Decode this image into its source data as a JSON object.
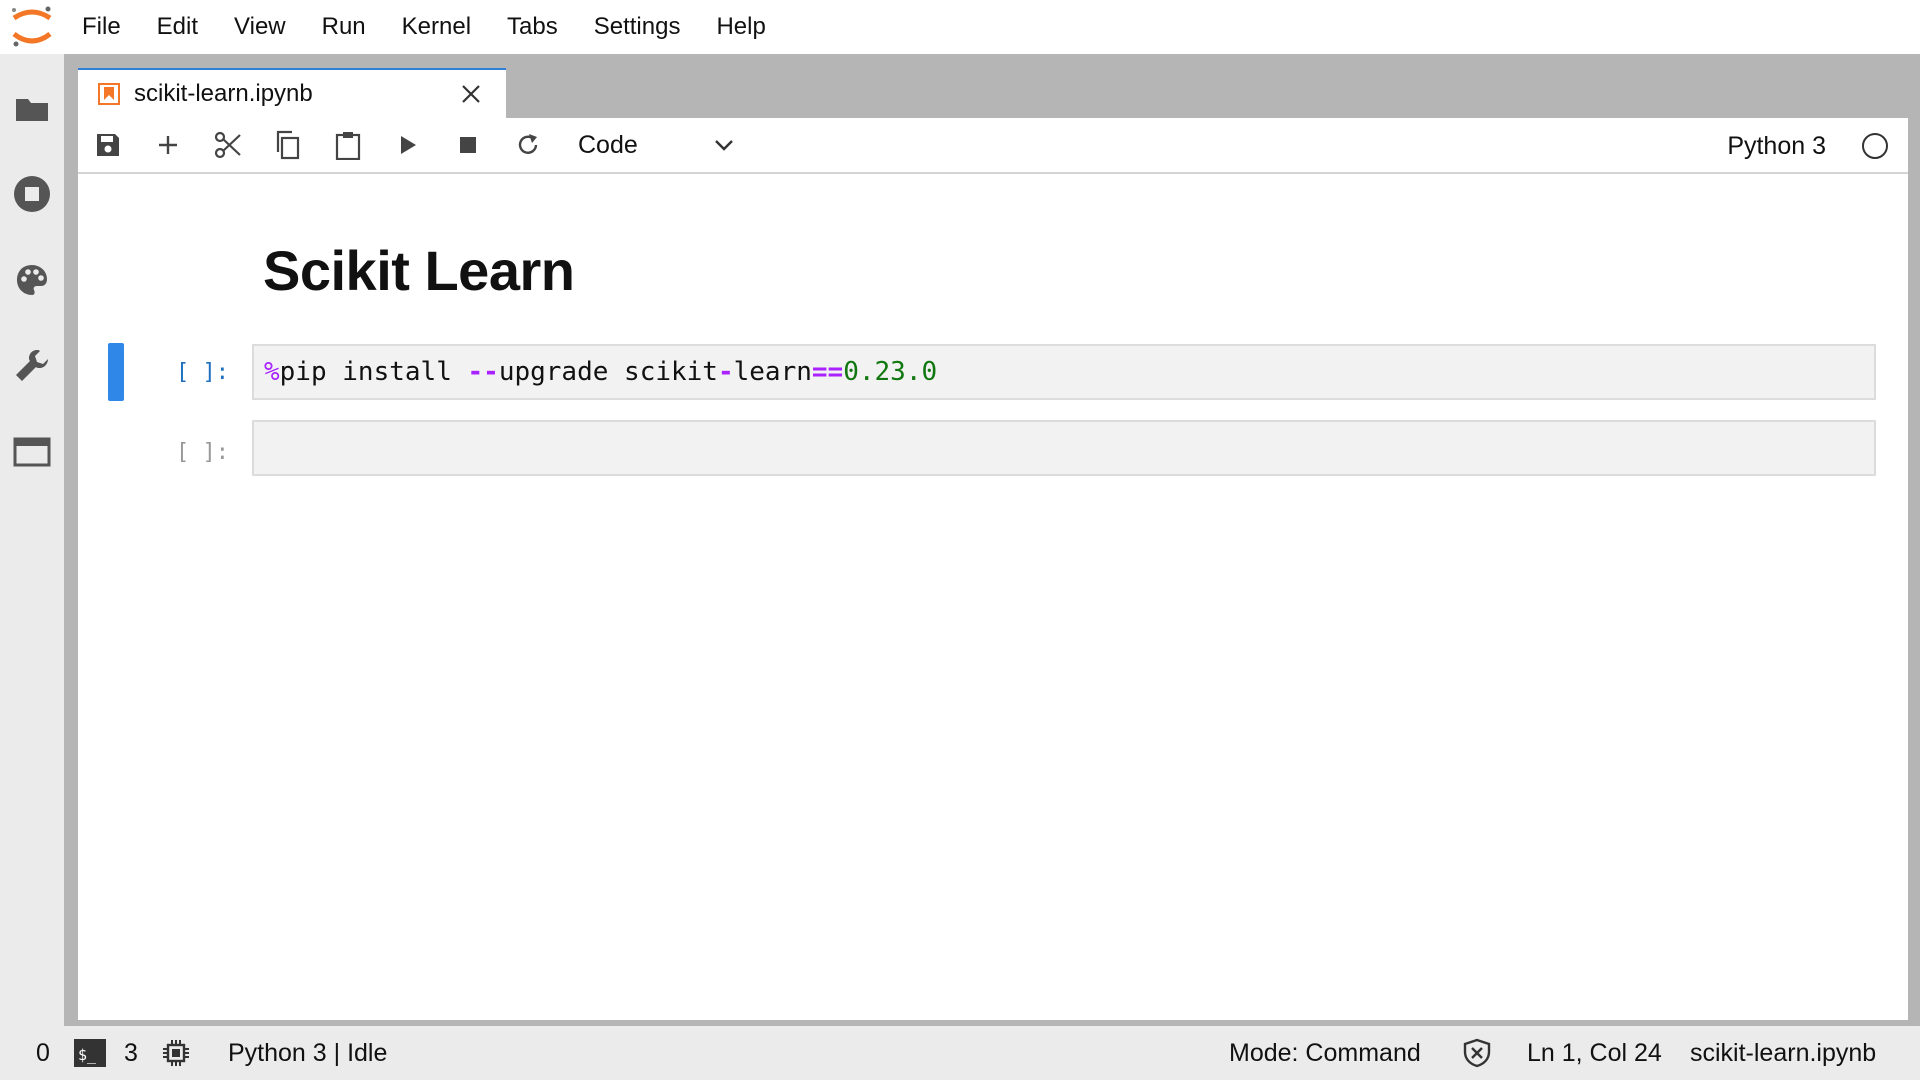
{
  "menubar": {
    "items": [
      "File",
      "Edit",
      "View",
      "Run",
      "Kernel",
      "Tabs",
      "Settings",
      "Help"
    ]
  },
  "sidebar": {
    "icons": [
      "folder-icon",
      "running-icon",
      "palette-icon",
      "wrench-icon",
      "tabs-icon"
    ]
  },
  "tab": {
    "title": "scikit-learn.ipynb",
    "icon": "notebook-icon"
  },
  "toolbar": {
    "buttons": [
      "save-icon",
      "plus-icon",
      "cut-icon",
      "copy-icon",
      "paste-icon",
      "run-icon",
      "stop-icon",
      "restart-icon"
    ],
    "cell_type": "Code",
    "kernel_name": "Python 3"
  },
  "notebook": {
    "heading": "Scikit Learn",
    "cells": [
      {
        "prompt": "[ ]:",
        "code": {
          "magic": "%",
          "cmd": "pip install ",
          "dash": "--",
          "arg": "upgrade scikit",
          "dash2": "-",
          "arg2": "learn",
          "eq": "==",
          "version": "0.23.0"
        }
      },
      {
        "prompt": "[ ]:",
        "code": ""
      }
    ]
  },
  "statusbar": {
    "left_count": "0",
    "terminal_count": "3",
    "kernel_status": "Python 3 | Idle",
    "mode": "Mode: Command",
    "position": "Ln 1, Col 24",
    "filename": "scikit-learn.ipynb"
  },
  "colors": {
    "accent": "#2f87e8",
    "logo": "#f37726",
    "magic": "#aa22ff",
    "number": "#117711"
  }
}
